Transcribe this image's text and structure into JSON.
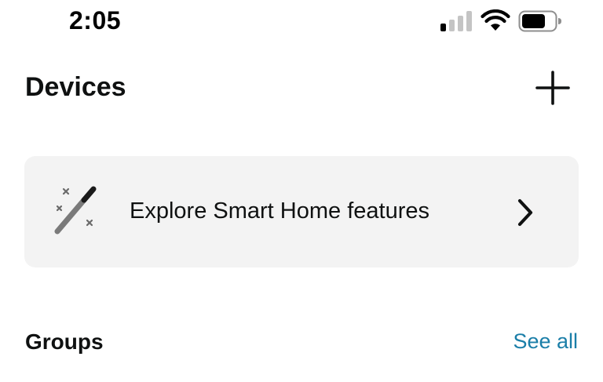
{
  "status_bar": {
    "time": "2:05",
    "icons": [
      "cellular-signal-icon",
      "wifi-icon",
      "battery-icon"
    ]
  },
  "header": {
    "title": "Devices",
    "add_icon": "plus-icon"
  },
  "explore_card": {
    "icon": "magic-wand-icon",
    "label": "Explore Smart Home features",
    "chevron": "chevron-right-icon"
  },
  "groups": {
    "title": "Groups",
    "see_all_label": "See all"
  },
  "colors": {
    "background": "#ffffff",
    "card_background": "#f3f3f3",
    "text": "#0f1111",
    "link": "#1a7ea8"
  }
}
